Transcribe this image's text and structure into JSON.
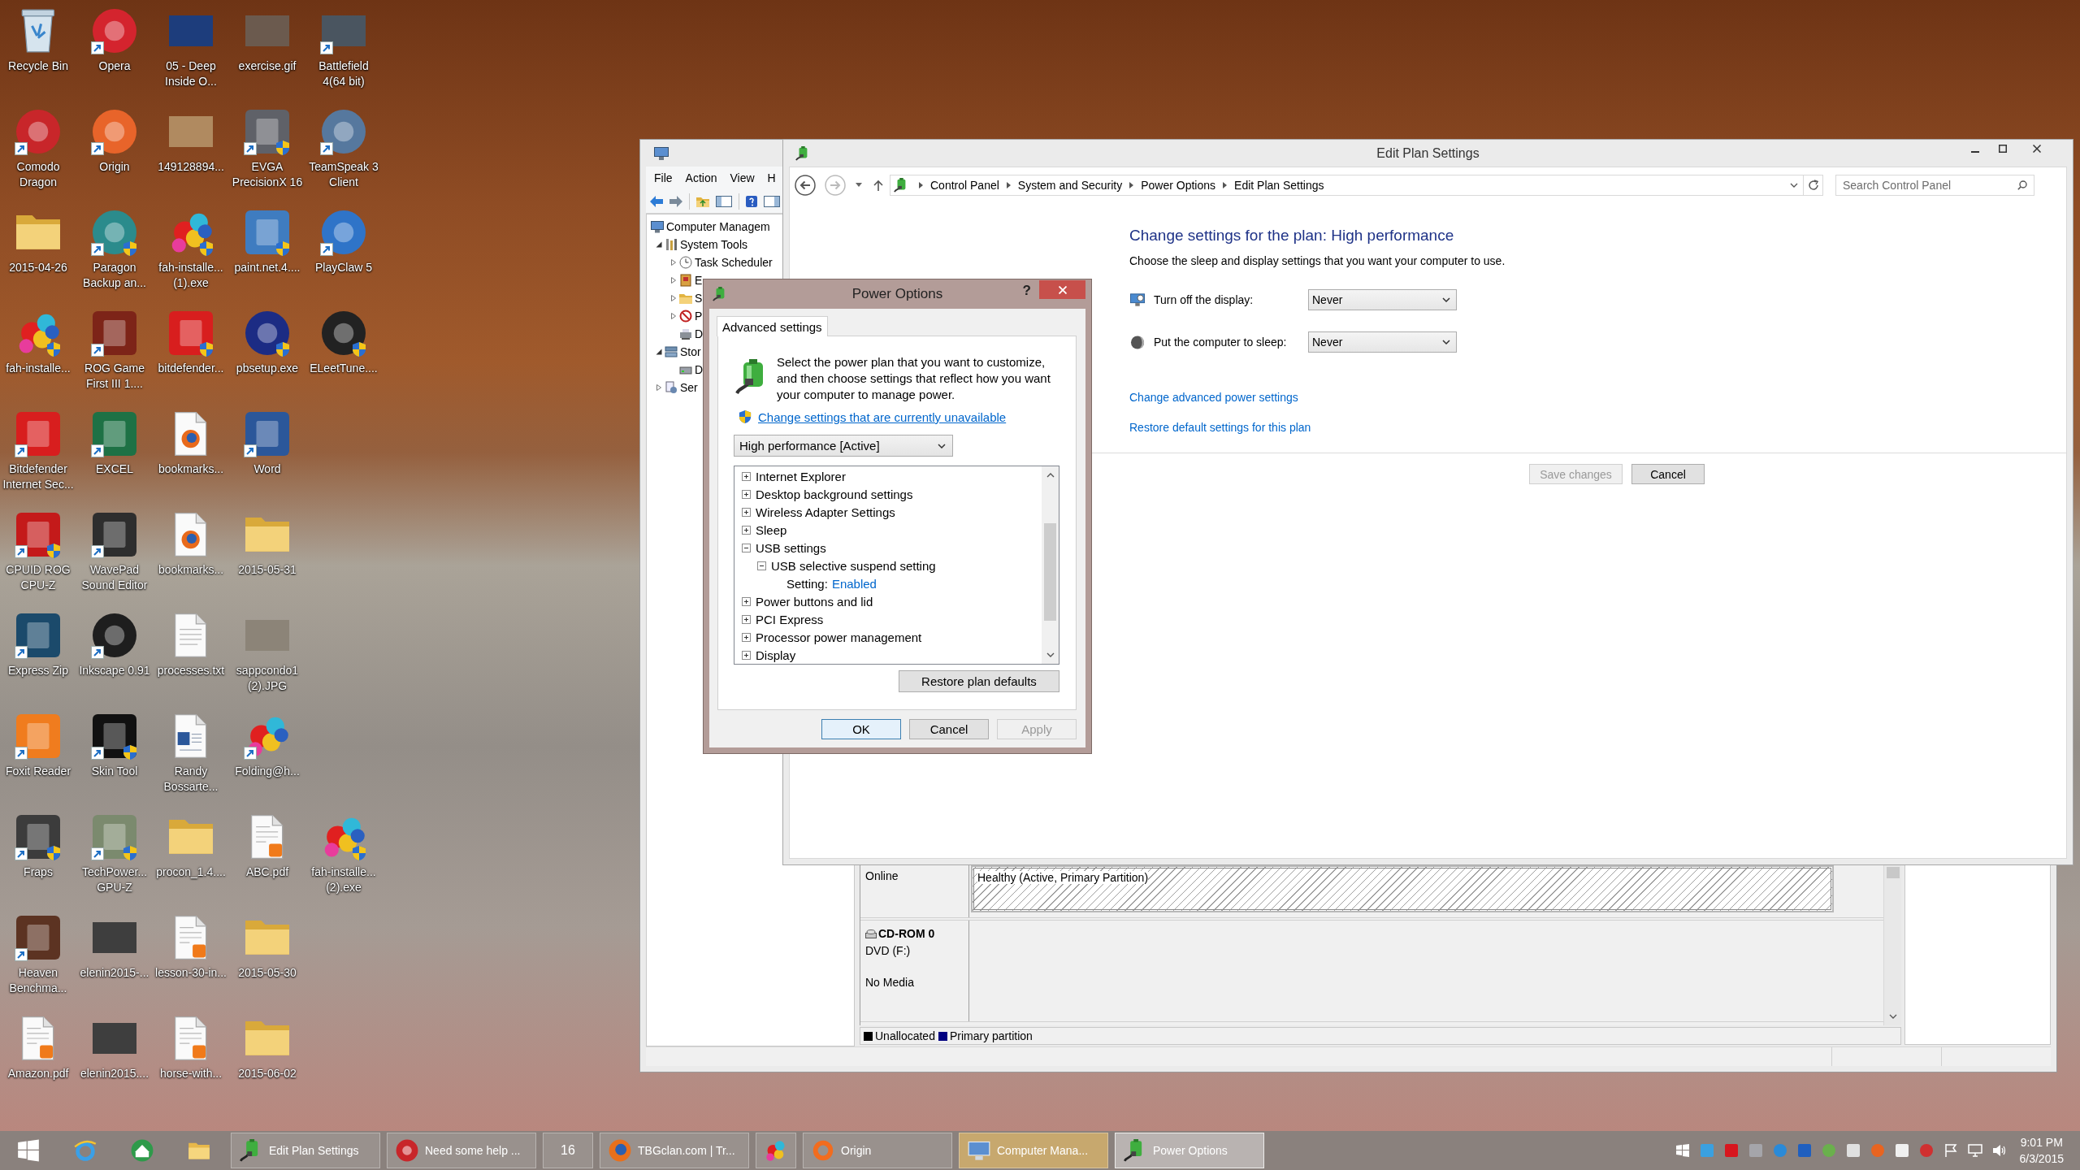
{
  "desktop": {
    "icon_rows": [
      [
        {
          "label": "Recycle Bin",
          "kind": "bin",
          "shortcut": false,
          "shield": false
        },
        {
          "label": "Opera",
          "kind": "disc",
          "color": "#d4242e",
          "shortcut": true,
          "shield": false
        },
        {
          "label": "05 - Deep Inside O...",
          "kind": "photo",
          "color": "#1d3d7c",
          "shortcut": false,
          "shield": false
        },
        {
          "label": "exercise.gif",
          "kind": "photo",
          "color": "#6b5a4e",
          "shortcut": false,
          "shield": false
        },
        {
          "label": "Battlefield 4(64 bit)",
          "kind": "photo",
          "color": "#4a5560",
          "shortcut": true,
          "shield": false
        }
      ],
      [
        {
          "label": "Comodo Dragon",
          "kind": "disc",
          "color": "#c8262a",
          "shortcut": true,
          "shield": false
        },
        {
          "label": "Origin",
          "kind": "disc",
          "color": "#e8642a",
          "shortcut": true,
          "shield": false
        },
        {
          "label": "149128894...",
          "kind": "photo",
          "color": "#b08a60",
          "shortcut": false,
          "shield": false
        },
        {
          "label": "EVGA PrecisionX 16",
          "kind": "tile",
          "color": "#5f6168",
          "shortcut": true,
          "shield": true
        },
        {
          "label": "TeamSpeak 3 Client",
          "kind": "disc",
          "color": "#56789e",
          "shortcut": true,
          "shield": false
        }
      ],
      [
        {
          "label": "2015-04-26",
          "kind": "folder",
          "shortcut": false,
          "shield": false
        },
        {
          "label": "Paragon Backup an...",
          "kind": "disc",
          "color": "#2b8b8c",
          "shortcut": true,
          "shield": true
        },
        {
          "label": "fah-installe... (1).exe",
          "kind": "molecule",
          "shortcut": false,
          "shield": true
        },
        {
          "label": "paint.net.4....",
          "kind": "tile",
          "color": "#3f7cc0",
          "shortcut": false,
          "shield": true
        },
        {
          "label": "PlayClaw 5",
          "kind": "disc",
          "color": "#2f74c8",
          "shortcut": true,
          "shield": false
        }
      ],
      [
        {
          "label": "fah-installe...",
          "kind": "molecule",
          "shortcut": false,
          "shield": true
        },
        {
          "label": "ROG Game First III 1....",
          "kind": "tile",
          "color": "#7d2418",
          "shortcut": true,
          "shield": false
        },
        {
          "label": "bitdefender...",
          "kind": "tile",
          "color": "#d81e1e",
          "shortcut": false,
          "shield": true
        },
        {
          "label": "pbsetup.exe",
          "kind": "disc",
          "color": "#1c2c84",
          "shortcut": false,
          "shield": true
        },
        {
          "label": "ELeetTune....",
          "kind": "disc",
          "color": "#222222",
          "shortcut": false,
          "shield": true
        }
      ],
      [
        {
          "label": "Bitdefender Internet Sec...",
          "kind": "tile",
          "color": "#d81e1e",
          "shortcut": true,
          "shield": false
        },
        {
          "label": "EXCEL",
          "kind": "tile",
          "color": "#1e7145",
          "shortcut": true,
          "shield": false
        },
        {
          "label": "bookmarks...",
          "kind": "webdoc",
          "shortcut": false,
          "shield": false
        },
        {
          "label": "Word",
          "kind": "tile",
          "color": "#2b579a",
          "shortcut": true,
          "shield": false
        }
      ],
      [
        {
          "label": "CPUID ROG CPU-Z",
          "kind": "tile",
          "color": "#c41a1a",
          "shortcut": true,
          "shield": true
        },
        {
          "label": "WavePad Sound Editor",
          "kind": "tile",
          "color": "#2e2e2e",
          "shortcut": true,
          "shield": false
        },
        {
          "label": "bookmarks...",
          "kind": "webdoc",
          "shortcut": false,
          "shield": false
        },
        {
          "label": "2015-05-31",
          "kind": "folder",
          "shortcut": false,
          "shield": false
        }
      ],
      [
        {
          "label": "Express Zip",
          "kind": "tile",
          "color": "#1b4a6b",
          "shortcut": true,
          "shield": false
        },
        {
          "label": "Inkscape 0.91",
          "kind": "disc",
          "color": "#1e1e1e",
          "shortcut": true,
          "shield": false
        },
        {
          "label": "processes.txt",
          "kind": "doc",
          "shortcut": false,
          "shield": false
        },
        {
          "label": "sappcondo1 (2).JPG",
          "kind": "photo",
          "color": "#8c8478",
          "shortcut": false,
          "shield": false
        }
      ],
      [
        {
          "label": "Foxit Reader",
          "kind": "tile",
          "color": "#f07c1e",
          "shortcut": true,
          "shield": false
        },
        {
          "label": "Skin Tool",
          "kind": "tile",
          "color": "#111111",
          "shortcut": true,
          "shield": true
        },
        {
          "label": "Randy Bossarte...",
          "kind": "worddoc",
          "shortcut": false,
          "shield": false
        },
        {
          "label": "Folding@h...",
          "kind": "molecule",
          "shortcut": true,
          "shield": false
        }
      ],
      [
        {
          "label": "Fraps",
          "kind": "tile",
          "color": "#3c3c3c",
          "shortcut": true,
          "shield": true
        },
        {
          "label": "TechPower... GPU-Z",
          "kind": "tile",
          "color": "#7b8a6e",
          "shortcut": true,
          "shield": true
        },
        {
          "label": "procon_1.4....",
          "kind": "folder",
          "shortcut": false,
          "shield": false
        },
        {
          "label": "ABC.pdf",
          "kind": "pdf",
          "shortcut": false,
          "shield": false
        },
        {
          "label": "fah-installe... (2).exe",
          "kind": "molecule",
          "shortcut": false,
          "shield": true
        }
      ],
      [
        {
          "label": "Heaven Benchma...",
          "kind": "tile",
          "color": "#5c3322",
          "shortcut": true,
          "shield": false
        },
        {
          "label": "elenin2015-...",
          "kind": "photo",
          "color": "#3e3e3e",
          "shortcut": false,
          "shield": false
        },
        {
          "label": "lesson-30-in...",
          "kind": "pdf",
          "shortcut": false,
          "shield": false
        },
        {
          "label": "2015-05-30",
          "kind": "folder",
          "shortcut": false,
          "shield": false
        }
      ],
      [
        {
          "label": "Amazon.pdf",
          "kind": "pdf",
          "shortcut": false,
          "shield": false
        },
        {
          "label": "elenin2015....",
          "kind": "photo",
          "color": "#3e3e3e",
          "shortcut": false,
          "shield": false
        },
        {
          "label": "horse-with...",
          "kind": "pdf",
          "shortcut": false,
          "shield": false
        },
        {
          "label": "2015-06-02",
          "kind": "folder",
          "shortcut": false,
          "shield": false
        }
      ]
    ]
  },
  "computer_management": {
    "menu": [
      "File",
      "Action",
      "View",
      "H"
    ],
    "tree": [
      {
        "label": "Computer Managem",
        "kind": "computer",
        "children": [
          {
            "label": "System Tools",
            "kind": "tools",
            "expanded": true,
            "children": [
              {
                "label": "Task Scheduler",
                "kind": "clock",
                "expanded": false
              },
              {
                "label": "E",
                "kind": "log",
                "expanded": false
              },
              {
                "label": "S",
                "kind": "share",
                "expanded": false
              },
              {
                "label": "P",
                "kind": "meter",
                "expanded": false
              },
              {
                "label": "D",
                "kind": "device"
              }
            ]
          },
          {
            "label": "Stor",
            "kind": "storage",
            "expanded": true,
            "children": [
              {
                "label": "D",
                "kind": "disk"
              }
            ]
          },
          {
            "label": "Ser",
            "kind": "services",
            "expanded": false
          }
        ]
      }
    ],
    "disks": [
      {
        "kind": "disk",
        "status": "Online",
        "partition": "Healthy (Active, Primary Partition)"
      },
      {
        "kind": "cdrom",
        "name": "CD-ROM 0",
        "type": "DVD (F:)",
        "status": "No Media"
      }
    ],
    "legend": [
      {
        "label": "Unallocated",
        "color": "#000000"
      },
      {
        "label": "Primary partition",
        "color": "#000080"
      }
    ]
  },
  "edit_plan": {
    "title": "Edit Plan Settings",
    "breadcrumb": [
      "Control Panel",
      "System and Security",
      "Power Options",
      "Edit Plan Settings"
    ],
    "search": {
      "placeholder": "Search Control Panel"
    },
    "heading": "Change settings for the plan: High performance",
    "intro": "Choose the sleep and display settings that you want your computer to use.",
    "settings": [
      {
        "kind": "display",
        "label": "Turn off the display:",
        "value": "Never"
      },
      {
        "kind": "sleep",
        "label": "Put the computer to sleep:",
        "value": "Never"
      }
    ],
    "links": [
      "Change advanced power settings",
      "Restore default settings for this plan"
    ],
    "buttons": [
      {
        "label": "Save changes",
        "disabled": true
      },
      {
        "label": "Cancel",
        "disabled": false
      }
    ]
  },
  "power_options": {
    "title": "Power Options",
    "help": "?",
    "tabs": [
      {
        "label": "Advanced settings",
        "selected": true
      }
    ],
    "intro": "Select the power plan that you want to customize, and then choose settings that reflect how you want your computer to manage power.",
    "admin_link": "Change settings that are currently unavailable",
    "plan": "High performance [Active]",
    "settings_tree": [
      {
        "label": "Internet Explorer",
        "expanded": false
      },
      {
        "label": "Desktop background settings",
        "expanded": false
      },
      {
        "label": "Wireless Adapter Settings",
        "expanded": false
      },
      {
        "label": "Sleep",
        "expanded": false
      },
      {
        "label": "USB settings",
        "expanded": true,
        "children": [
          {
            "label": "USB selective suspend setting",
            "expanded": true,
            "children": [
              {
                "kind": "value",
                "label": "Setting:",
                "value": "Enabled"
              }
            ]
          }
        ]
      },
      {
        "label": "Power buttons and lid",
        "expanded": false
      },
      {
        "label": "PCI Express",
        "expanded": false
      },
      {
        "label": "Processor power management",
        "expanded": false
      },
      {
        "label": "Display",
        "expanded": false
      }
    ],
    "restore_button": "Restore plan defaults",
    "buttons": [
      {
        "label": "OK",
        "default": true,
        "disabled": false
      },
      {
        "label": "Cancel",
        "default": false,
        "disabled": false
      },
      {
        "label": "Apply",
        "default": false,
        "disabled": true
      }
    ]
  },
  "taskbar": {
    "items": [
      {
        "kind": "start",
        "running": false,
        "selected": false,
        "flashing": false
      },
      {
        "kind": "ie",
        "running": false,
        "selected": false,
        "flashing": false
      },
      {
        "kind": "home",
        "running": false,
        "selected": false,
        "flashing": false
      },
      {
        "kind": "files",
        "running": false,
        "selected": false,
        "flashing": false
      },
      {
        "kind": "power",
        "label": "Edit Plan Settings",
        "running": true,
        "selected": false,
        "flashing": false
      },
      {
        "kind": "dragon",
        "label": "Need some help ...",
        "running": true,
        "selected": false,
        "flashing": false
      },
      {
        "kind": "text",
        "label": "16",
        "running": true,
        "selected": false,
        "flashing": false
      },
      {
        "kind": "firefox",
        "label": "TBGclan.com | Tr...",
        "running": true,
        "selected": false,
        "flashing": false
      },
      {
        "kind": "molecule",
        "running": true,
        "selected": false,
        "flashing": false
      },
      {
        "kind": "origin",
        "label": "Origin",
        "running": true,
        "selected": false,
        "flashing": false
      },
      {
        "kind": "computer",
        "label": "Computer Mana...",
        "running": true,
        "selected": false,
        "flashing": true
      },
      {
        "kind": "power",
        "label": "Power Options",
        "running": true,
        "selected": true,
        "flashing": false
      }
    ],
    "clock": {
      "time": "9:01 PM",
      "date": "6/3/2015"
    }
  }
}
